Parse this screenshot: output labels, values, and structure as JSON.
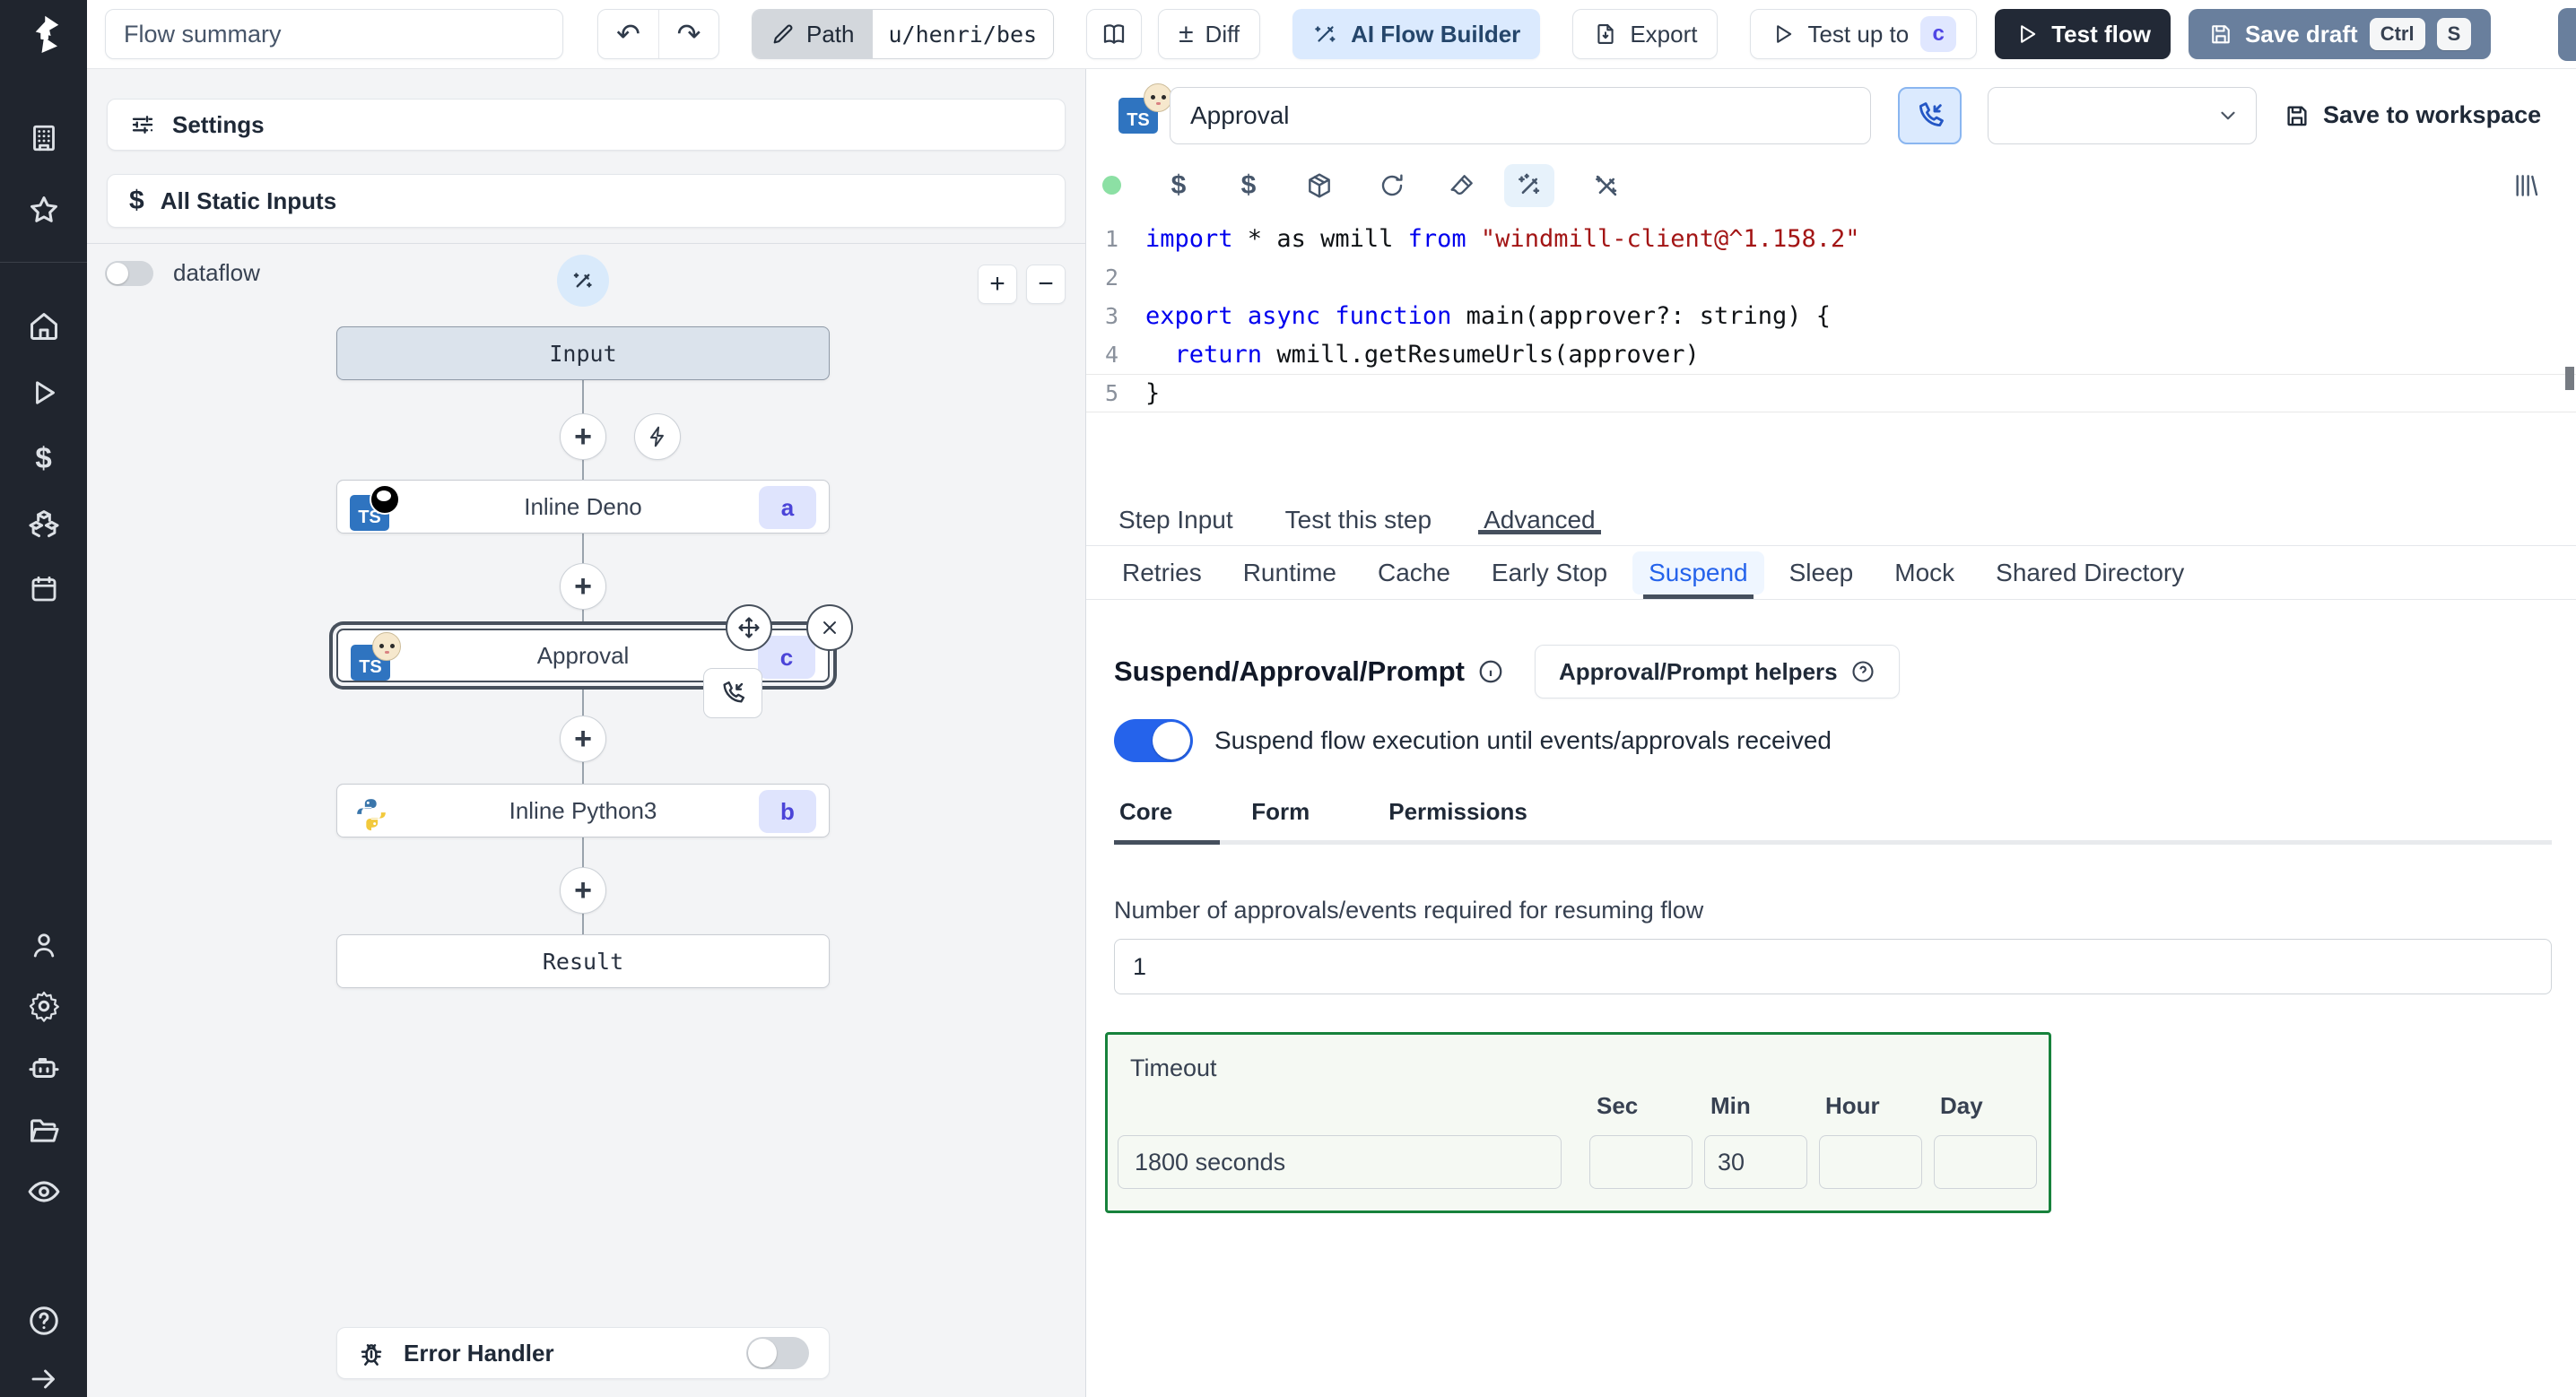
{
  "colors": {
    "accent_blue": "#2563eb",
    "rail_bg": "#20252e",
    "save_draft_bg": "#697f9d",
    "test_flow_bg": "#222936",
    "timeout_green": "#17823c",
    "badge_bg": "#e0e7ff",
    "badge_text": "#4f46e5",
    "keyword": "#0000ee",
    "string": "#a31515",
    "suspend_tab_bg": "#eff6ff"
  },
  "icons": {
    "diff": "±",
    "undo": "↶",
    "redo": "↷",
    "plus": "+",
    "minus": "−",
    "dollar": "$",
    "ts": "TS",
    "info": "i",
    "question": "?",
    "rail": [
      "windmill-logo",
      "workspace-icon",
      "favorites-icon",
      "home-icon",
      "runs-icon",
      "variables-icon",
      "resources-icon",
      "schedules-icon",
      "users-icon",
      "settings-icon",
      "workers-icon",
      "folders-icon",
      "audit-logs-icon",
      "help-icon",
      "collapse-sidebar-icon"
    ],
    "code_toolbar": [
      "status-dot",
      "schema-icon",
      "variables-icon",
      "package-icon",
      "reset-icon",
      "format-icon",
      "ai-generate-icon",
      "ai-fix-icon",
      "library-icon"
    ]
  },
  "topbar": {
    "flow_summary": "Flow summary",
    "path_label": "Path",
    "path_value": "u/henri/bes",
    "diff": "Diff",
    "ai_builder": "AI Flow Builder",
    "export": "Export",
    "test_up_to": "Test up to",
    "test_up_to_badge": "c",
    "test_flow": "Test flow",
    "save_draft": "Save draft",
    "kbd_ctrl": "Ctrl",
    "kbd_s": "S"
  },
  "flow": {
    "settings": "Settings",
    "all_static_inputs": "All Static Inputs",
    "dataflow": "dataflow",
    "zoom_in": "+",
    "zoom_out": "−",
    "nodes": {
      "input": {
        "label": "Input"
      },
      "deno": {
        "label": "Inline Deno",
        "badge": "a",
        "lang": "deno"
      },
      "approval": {
        "label": "Approval",
        "badge": "c",
        "lang": "bun"
      },
      "python": {
        "label": "Inline Python3",
        "badge": "b",
        "lang": "python3"
      },
      "result": {
        "label": "Result"
      }
    },
    "error_handler": "Error Handler"
  },
  "step": {
    "name": "Approval",
    "save_to_workspace": "Save to workspace",
    "tabs_main": [
      {
        "label": "Step Input",
        "active": false
      },
      {
        "label": "Test this step",
        "active": false
      },
      {
        "label": "Advanced",
        "active": true
      }
    ],
    "tabs_advanced": [
      {
        "label": "Retries",
        "active": false
      },
      {
        "label": "Runtime",
        "active": false
      },
      {
        "label": "Cache",
        "active": false
      },
      {
        "label": "Early Stop",
        "active": false
      },
      {
        "label": "Suspend",
        "active": true
      },
      {
        "label": "Sleep",
        "active": false
      },
      {
        "label": "Mock",
        "active": false
      },
      {
        "label": "Shared Directory",
        "active": false
      }
    ]
  },
  "code": {
    "lines": [
      {
        "n": 1,
        "tokens": [
          {
            "c": "kw",
            "t": "import"
          },
          {
            "c": "p",
            "t": " * as wmill "
          },
          {
            "c": "kw",
            "t": "from"
          },
          {
            "c": "p",
            "t": " "
          },
          {
            "c": "str",
            "t": "\"windmill-client@^1.158.2\""
          }
        ]
      },
      {
        "n": 2,
        "tokens": []
      },
      {
        "n": 3,
        "tokens": [
          {
            "c": "kw",
            "t": "export"
          },
          {
            "c": "p",
            "t": " "
          },
          {
            "c": "kw",
            "t": "async"
          },
          {
            "c": "p",
            "t": " "
          },
          {
            "c": "kw",
            "t": "function"
          },
          {
            "c": "p",
            "t": " main(approver?: string) {"
          }
        ]
      },
      {
        "n": 4,
        "tokens": [
          {
            "c": "p",
            "t": "  "
          },
          {
            "c": "kw",
            "t": "return"
          },
          {
            "c": "p",
            "t": " wmill.getResumeUrls(approver)"
          }
        ]
      },
      {
        "n": 5,
        "tokens": [
          {
            "c": "p",
            "t": "}"
          }
        ],
        "current": true
      }
    ]
  },
  "suspend": {
    "title": "Suspend/Approval/Prompt",
    "helpers": "Approval/Prompt helpers",
    "toggle_label": "Suspend flow execution until events/approvals received",
    "tabs": [
      {
        "label": "Core",
        "active": true
      },
      {
        "label": "Form",
        "active": false
      },
      {
        "label": "Permissions",
        "active": false
      }
    ],
    "approvals_label": "Number of approvals/events required for resuming flow",
    "approvals_value": "1",
    "timeout_label": "Timeout",
    "timeout_value": "1800 seconds",
    "units": [
      "Sec",
      "Min",
      "Hour",
      "Day"
    ],
    "sec_value": "",
    "min_value": "30",
    "hour_value": "",
    "day_value": ""
  }
}
